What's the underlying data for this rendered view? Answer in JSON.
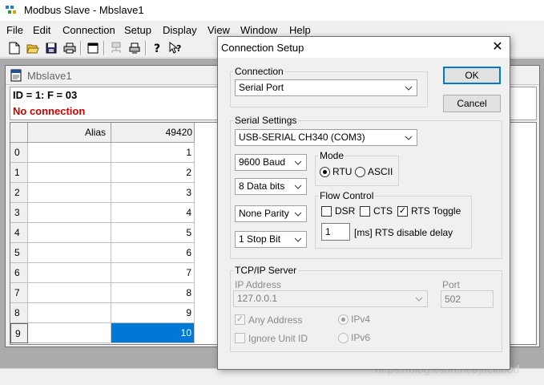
{
  "app": {
    "title": "Modbus Slave - Mbslave1",
    "menu": [
      "File",
      "Edit",
      "Connection",
      "Setup",
      "Display",
      "View",
      "Window",
      "Help"
    ]
  },
  "child": {
    "title": "Mbslave1",
    "id_line": "ID = 1: F = 03",
    "status": "No connection",
    "status_color": "#d00000",
    "grid": {
      "headers": [
        "Alias",
        "49420"
      ],
      "rows": [
        {
          "num": "0",
          "value": "1"
        },
        {
          "num": "1",
          "value": "2"
        },
        {
          "num": "2",
          "value": "3"
        },
        {
          "num": "3",
          "value": "4"
        },
        {
          "num": "4",
          "value": "5"
        },
        {
          "num": "5",
          "value": "6"
        },
        {
          "num": "6",
          "value": "7"
        },
        {
          "num": "7",
          "value": "8"
        },
        {
          "num": "8",
          "value": "9"
        },
        {
          "num": "9",
          "value": "10"
        }
      ],
      "selected_row": "9",
      "selection_color": "#0078d7"
    }
  },
  "dialog": {
    "title": "Connection Setup",
    "ok_label": "OK",
    "cancel_label": "Cancel",
    "connection": {
      "group_label": "Connection",
      "value": "Serial Port"
    },
    "serial": {
      "group_label": "Serial Settings",
      "port": "USB-SERIAL CH340 (COM3)",
      "baud": "9600 Baud",
      "data_bits": "8 Data bits",
      "parity": "None Parity",
      "stop_bits": "1 Stop Bit",
      "mode": {
        "label": "Mode",
        "rtu_label": "RTU",
        "ascii_label": "ASCII",
        "selected": "RTU"
      },
      "flow": {
        "label": "Flow Control",
        "dsr_label": "DSR",
        "dsr_checked": false,
        "cts_label": "CTS",
        "cts_checked": false,
        "rts_label": "RTS Toggle",
        "rts_checked": true,
        "delay_value": "1",
        "delay_label": "[ms] RTS disable delay"
      }
    },
    "tcp": {
      "group_label": "TCP/IP Server",
      "ip_label": "IP Address",
      "ip_value": "127.0.0.1",
      "port_label": "Port",
      "port_value": "502",
      "any_address_label": "Any Address",
      "any_address_checked": true,
      "ignore_unit_label": "Ignore Unit ID",
      "ignore_unit_checked": false,
      "ipv4_label": "IPv4",
      "ipv6_label": "IPv6",
      "ip_version_selected": "IPv4"
    }
  },
  "watermark": "https://blog.csdn.net/jacklood"
}
